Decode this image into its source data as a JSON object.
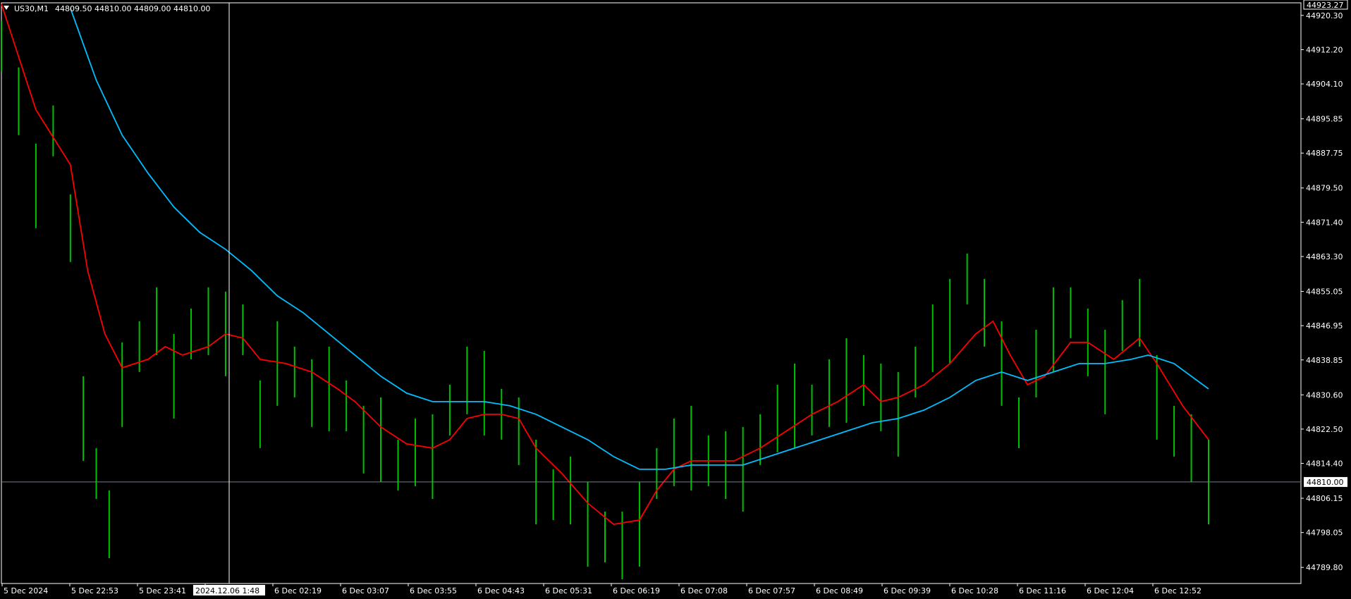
{
  "window": {
    "symbol_timeframe": "US30,M1",
    "ohlc": "44809.50 44810.00 44809.00 44810.00"
  },
  "price_axis": {
    "labels": [
      "44920.30",
      "44912.20",
      "44904.10",
      "44895.85",
      "44887.75",
      "44879.50",
      "44871.40",
      "44863.30",
      "44855.05",
      "44846.95",
      "44838.85",
      "44830.60",
      "44822.50",
      "44814.40",
      "44806.15",
      "44798.05",
      "44789.80"
    ],
    "high_label": "44923.27",
    "current_price_label": "44810.00"
  },
  "time_axis": {
    "labels": [
      "5 Dec 2024",
      "5 Dec 22:53",
      "5 Dec 23:41",
      "",
      "6 Dec 02:19",
      "6 Dec 03:07",
      "6 Dec 03:55",
      "6 Dec 04:43",
      "6 Dec 05:31",
      "6 Dec 06:19",
      "6 Dec 07:08",
      "6 Dec 07:57",
      "6 Dec 08:49",
      "6 Dec 09:39",
      "6 Dec 10:28",
      "6 Dec 11:16",
      "6 Dec 12:04",
      "6 Dec 12:52"
    ],
    "crosshair_label": "2024.12.06 1:48"
  },
  "colors": {
    "background": "#000000",
    "frame": "#ffffff",
    "bars": "#00c000",
    "ma_fast": "#ff0000",
    "ma_slow": "#00bfff",
    "price_line": "#708090"
  },
  "chart_data": {
    "type": "line",
    "title": "US30,M1",
    "ylim": [
      44786.0,
      44923.27
    ],
    "series": [
      {
        "name": "",
        "color": "#00c000",
        "style": "bars",
        "points": [
          [
            0,
            44913
          ],
          [
            20,
            44900
          ],
          [
            40,
            44880
          ],
          [
            60,
            44893
          ],
          [
            80,
            44870
          ],
          [
            95,
            44825
          ],
          [
            110,
            44812
          ],
          [
            125,
            44800
          ],
          [
            140,
            44833
          ],
          [
            160,
            44842
          ],
          [
            180,
            44848
          ],
          [
            200,
            44835
          ],
          [
            220,
            44845
          ],
          [
            240,
            44848
          ],
          [
            260,
            44845
          ],
          [
            280,
            44846
          ],
          [
            300,
            44826
          ],
          [
            320,
            44838
          ],
          [
            340,
            44836
          ],
          [
            360,
            44831
          ],
          [
            380,
            44832
          ],
          [
            400,
            44828
          ],
          [
            420,
            44820
          ],
          [
            440,
            44820
          ],
          [
            460,
            44814
          ],
          [
            480,
            44817
          ],
          [
            500,
            44816
          ],
          [
            520,
            44827
          ],
          [
            540,
            44834
          ],
          [
            560,
            44831
          ],
          [
            580,
            44826
          ],
          [
            600,
            44822
          ],
          [
            620,
            44810
          ],
          [
            640,
            44807
          ],
          [
            660,
            44808
          ],
          [
            680,
            44800
          ],
          [
            700,
            44797
          ],
          [
            720,
            44795
          ],
          [
            740,
            44800
          ],
          [
            760,
            44812
          ],
          [
            780,
            44817
          ],
          [
            800,
            44818
          ],
          [
            820,
            44815
          ],
          [
            840,
            44814
          ],
          [
            860,
            44813
          ],
          [
            880,
            44820
          ],
          [
            900,
            44825
          ],
          [
            920,
            44828
          ],
          [
            940,
            44827
          ],
          [
            960,
            44831
          ],
          [
            980,
            44834
          ],
          [
            1000,
            44834
          ],
          [
            1020,
            44830
          ],
          [
            1040,
            44826
          ],
          [
            1060,
            44836
          ],
          [
            1080,
            44844
          ],
          [
            1100,
            44848
          ],
          [
            1120,
            44858
          ],
          [
            1140,
            44850
          ],
          [
            1160,
            44838
          ],
          [
            1180,
            44824
          ],
          [
            1200,
            44838
          ],
          [
            1220,
            44846
          ],
          [
            1240,
            44850
          ],
          [
            1260,
            44843
          ],
          [
            1280,
            44836
          ],
          [
            1300,
            44847
          ],
          [
            1320,
            44850
          ],
          [
            1340,
            44830
          ],
          [
            1360,
            44822
          ],
          [
            1380,
            44818
          ],
          [
            1400,
            44810
          ]
        ]
      },
      {
        "name": "",
        "color": "#ff0000",
        "style": "line",
        "points": [
          [
            0,
            44923
          ],
          [
            40,
            44898
          ],
          [
            80,
            44885
          ],
          [
            100,
            44860
          ],
          [
            120,
            44845
          ],
          [
            140,
            44837
          ],
          [
            170,
            44839
          ],
          [
            190,
            44842
          ],
          [
            210,
            44840
          ],
          [
            240,
            44842
          ],
          [
            260,
            44845
          ],
          [
            280,
            44844
          ],
          [
            300,
            44839
          ],
          [
            330,
            44838
          ],
          [
            360,
            44836
          ],
          [
            390,
            44832
          ],
          [
            410,
            44829
          ],
          [
            440,
            44823
          ],
          [
            470,
            44819
          ],
          [
            500,
            44818
          ],
          [
            520,
            44820
          ],
          [
            540,
            44825
          ],
          [
            560,
            44826
          ],
          [
            580,
            44826
          ],
          [
            600,
            44825
          ],
          [
            620,
            44818
          ],
          [
            650,
            44812
          ],
          [
            680,
            44805
          ],
          [
            710,
            44800
          ],
          [
            740,
            44801
          ],
          [
            760,
            44808
          ],
          [
            780,
            44813
          ],
          [
            800,
            44815
          ],
          [
            830,
            44815
          ],
          [
            850,
            44815
          ],
          [
            880,
            44818
          ],
          [
            910,
            44822
          ],
          [
            940,
            44826
          ],
          [
            970,
            44829
          ],
          [
            1000,
            44833
          ],
          [
            1020,
            44829
          ],
          [
            1040,
            44830
          ],
          [
            1070,
            44833
          ],
          [
            1100,
            44838
          ],
          [
            1130,
            44845
          ],
          [
            1150,
            44848
          ],
          [
            1170,
            44840
          ],
          [
            1190,
            44833
          ],
          [
            1210,
            44835
          ],
          [
            1240,
            44843
          ],
          [
            1260,
            44843
          ],
          [
            1290,
            44839
          ],
          [
            1320,
            44844
          ],
          [
            1340,
            44838
          ],
          [
            1370,
            44828
          ],
          [
            1400,
            44820
          ]
        ]
      },
      {
        "name": "",
        "color": "#00bfff",
        "style": "line",
        "points": [
          [
            80,
            44922
          ],
          [
            110,
            44905
          ],
          [
            140,
            44892
          ],
          [
            170,
            44883
          ],
          [
            200,
            44875
          ],
          [
            230,
            44869
          ],
          [
            260,
            44865
          ],
          [
            290,
            44860
          ],
          [
            320,
            44854
          ],
          [
            350,
            44850
          ],
          [
            380,
            44845
          ],
          [
            410,
            44840
          ],
          [
            440,
            44835
          ],
          [
            470,
            44831
          ],
          [
            500,
            44829
          ],
          [
            530,
            44829
          ],
          [
            560,
            44829
          ],
          [
            590,
            44828
          ],
          [
            620,
            44826
          ],
          [
            650,
            44823
          ],
          [
            680,
            44820
          ],
          [
            710,
            44816
          ],
          [
            740,
            44813
          ],
          [
            770,
            44813
          ],
          [
            800,
            44814
          ],
          [
            830,
            44814
          ],
          [
            860,
            44814
          ],
          [
            890,
            44816
          ],
          [
            920,
            44818
          ],
          [
            950,
            44820
          ],
          [
            980,
            44822
          ],
          [
            1010,
            44824
          ],
          [
            1040,
            44825
          ],
          [
            1070,
            44827
          ],
          [
            1100,
            44830
          ],
          [
            1130,
            44834
          ],
          [
            1160,
            44836
          ],
          [
            1190,
            44834
          ],
          [
            1220,
            44836
          ],
          [
            1250,
            44838
          ],
          [
            1280,
            44838
          ],
          [
            1310,
            44839
          ],
          [
            1330,
            44840
          ],
          [
            1360,
            44838
          ],
          [
            1380,
            44835
          ],
          [
            1400,
            44832
          ]
        ]
      }
    ]
  }
}
